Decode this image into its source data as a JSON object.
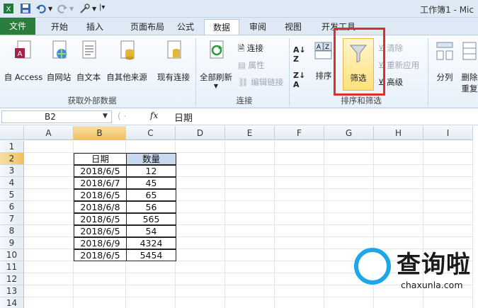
{
  "window": {
    "title": "工作簿1 - Mic"
  },
  "tabs": [
    {
      "label": "文件"
    },
    {
      "label": "开始"
    },
    {
      "label": "插入"
    },
    {
      "label": "页面布局"
    },
    {
      "label": "公式"
    },
    {
      "label": "数据"
    },
    {
      "label": "审阅"
    },
    {
      "label": "视图"
    },
    {
      "label": "开发工具"
    }
  ],
  "ribbon": {
    "external_data": {
      "access": "自 Access",
      "web": "自网站",
      "text": "自文本",
      "other": "自其他来源",
      "existing": "现有连接",
      "group_label": "获取外部数据"
    },
    "connections": {
      "refresh_all": "全部刷新",
      "connections": "连接",
      "properties": "属性",
      "edit_links": "编辑链接",
      "group_label": "连接"
    },
    "sort_filter": {
      "sort": "排序",
      "filter": "筛选",
      "clear": "清除",
      "reapply": "重新应用",
      "advanced": "高级",
      "group_label": "排序和筛选"
    },
    "data_tools": {
      "text_to_columns": "分列",
      "remove_dup_1": "删除",
      "remove_dup_2": "重复"
    }
  },
  "formula_bar": {
    "name_box": "B2",
    "fx": "fx",
    "value": "日期"
  },
  "columns": [
    "A",
    "B",
    "C",
    "D",
    "E",
    "F",
    "G",
    "H",
    "I"
  ],
  "rows": [
    "1",
    "2",
    "3",
    "4",
    "5",
    "6",
    "7",
    "8",
    "9",
    "10",
    "11",
    "12",
    "13",
    "14"
  ],
  "table": {
    "headers": [
      "日期",
      "数量"
    ],
    "rows": [
      [
        "2018/6/5",
        "12"
      ],
      [
        "2018/6/7",
        "45"
      ],
      [
        "2018/6/5",
        "65"
      ],
      [
        "2018/6/8",
        "56"
      ],
      [
        "2018/6/5",
        "565"
      ],
      [
        "2018/6/5",
        "54"
      ],
      [
        "2018/6/9",
        "4324"
      ],
      [
        "2018/6/5",
        "5454"
      ]
    ]
  },
  "watermark": {
    "brand": "查询啦",
    "url": "chaxunla.com"
  }
}
